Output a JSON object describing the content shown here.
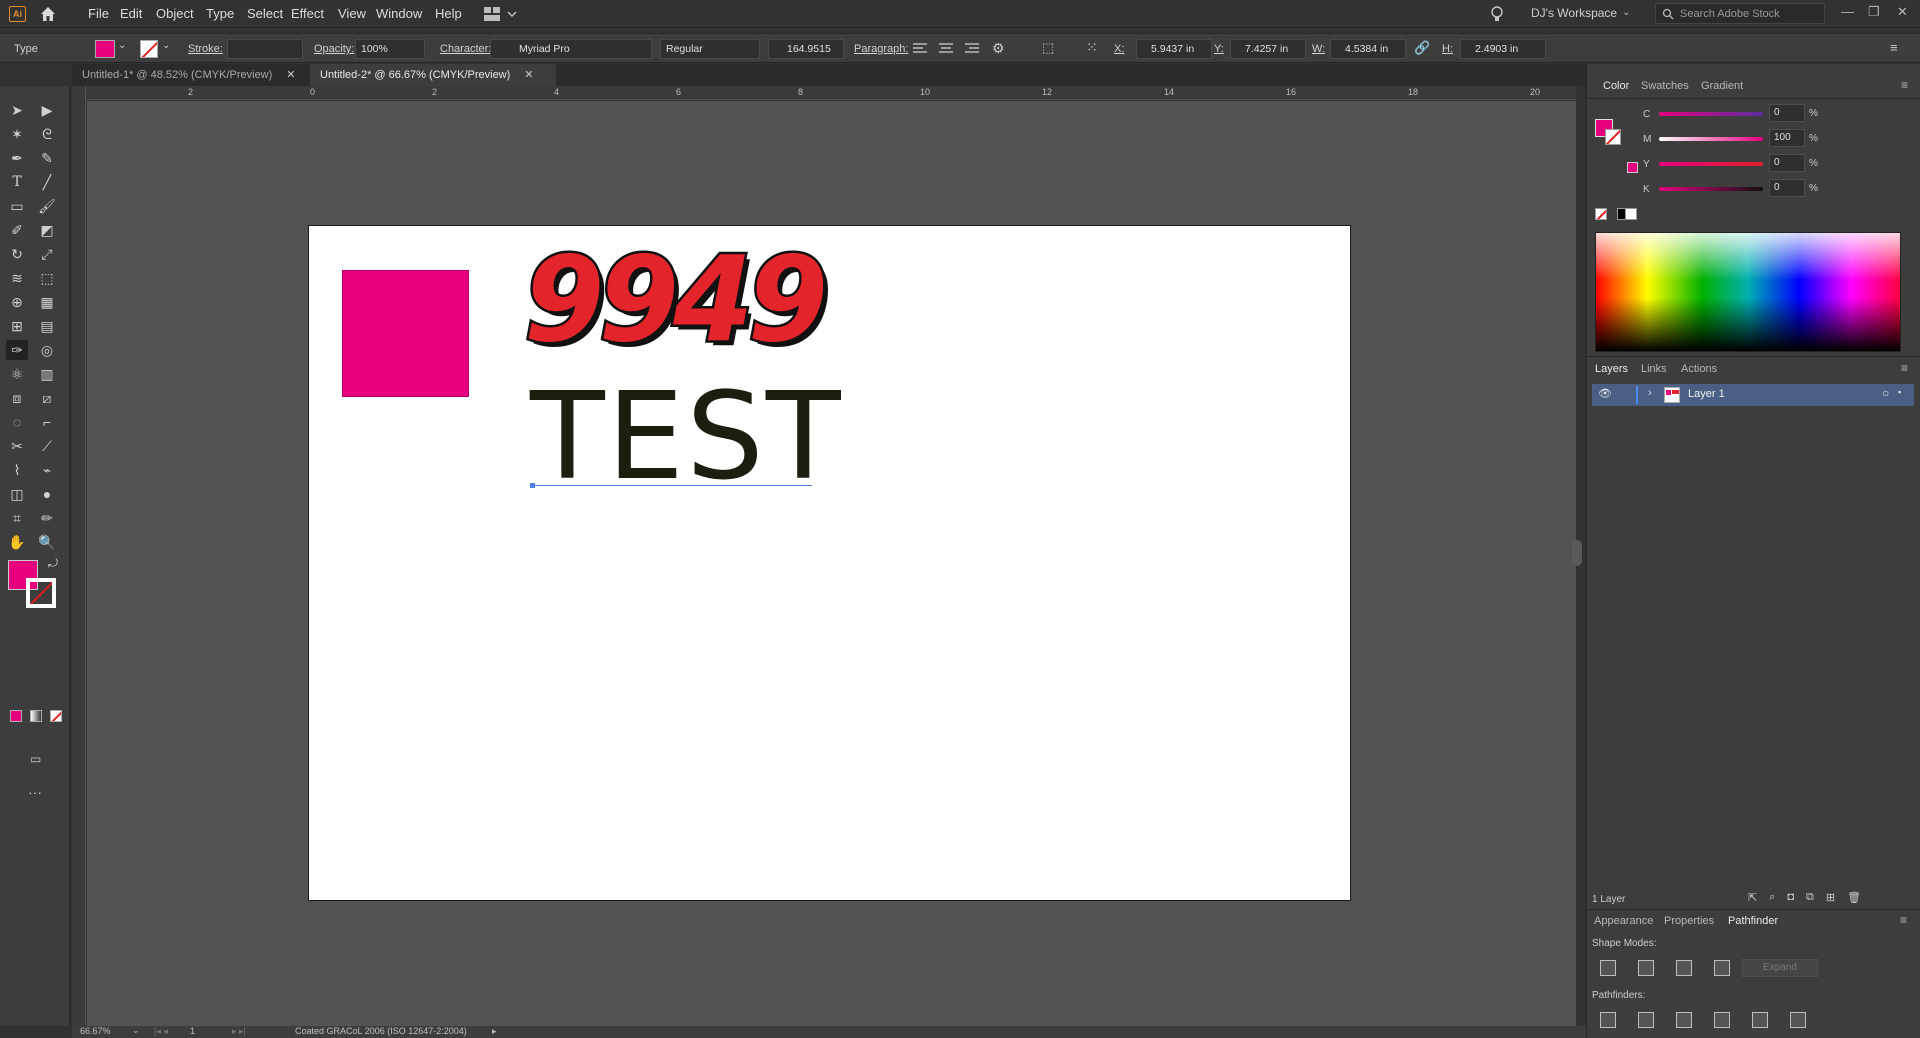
{
  "menubar": {
    "items": [
      "File",
      "Edit",
      "Object",
      "Type",
      "Select",
      "Effect",
      "View",
      "Window",
      "Help"
    ],
    "workspace": "DJ's Workspace",
    "search_placeholder": "Search Adobe Stock"
  },
  "controlbar": {
    "type_label": "Type",
    "stroke_label": "Stroke:",
    "opacity_label": "Opacity:",
    "opacity_value": "100%",
    "character_label": "Character:",
    "font_family": "Myriad Pro",
    "font_style": "Regular",
    "font_size": "164.9515",
    "paragraph_label": "Paragraph:",
    "x_label": "X:",
    "x_value": "5.9437 in",
    "y_label": "Y:",
    "y_value": "7.4257 in",
    "w_label": "W:",
    "w_value": "4.5384 in",
    "h_label": "H:",
    "h_value": "2.4903 in",
    "fill_color": "#e6007e"
  },
  "tabs": [
    {
      "label": "Untitled-1* @ 48.52% (CMYK/Preview)",
      "active": false
    },
    {
      "label": "Untitled-2* @ 66.67% (CMYK/Preview)",
      "active": true
    }
  ],
  "ruler": {
    "h_ticks": [
      "2",
      "0",
      "2",
      "4",
      "6",
      "8",
      "10",
      "12",
      "14",
      "16",
      "18",
      "20"
    ],
    "v_ticks": [
      "1",
      "2",
      "1",
      "0",
      "1",
      "8",
      "6",
      "4",
      "2",
      "0",
      "2"
    ]
  },
  "artboard": {
    "headline": "9949",
    "subline": "TEST",
    "square_color": "#e6007e",
    "headline_color": "#e3242b"
  },
  "color_panel": {
    "tabs": [
      "Color",
      "Swatches",
      "Gradient"
    ],
    "channels": [
      {
        "label": "C",
        "value": "0"
      },
      {
        "label": "M",
        "value": "100"
      },
      {
        "label": "Y",
        "value": "0"
      },
      {
        "label": "K",
        "value": "0"
      }
    ],
    "unit": "%"
  },
  "layers_panel": {
    "tabs": [
      "Layers",
      "Links",
      "Actions"
    ],
    "layers": [
      "Layer 1"
    ],
    "count_label": "1 Layer"
  },
  "bottom_panel": {
    "tabs": [
      "Appearance",
      "Properties",
      "Pathfinder"
    ],
    "shape_modes_label": "Shape Modes:",
    "expand_label": "Expand",
    "pathfinders_label": "Pathfinders:"
  },
  "statusbar": {
    "zoom": "66.67%",
    "artboard_num": "1",
    "profile": "Coated GRACoL 2006 (ISO 12647-2:2004)"
  }
}
